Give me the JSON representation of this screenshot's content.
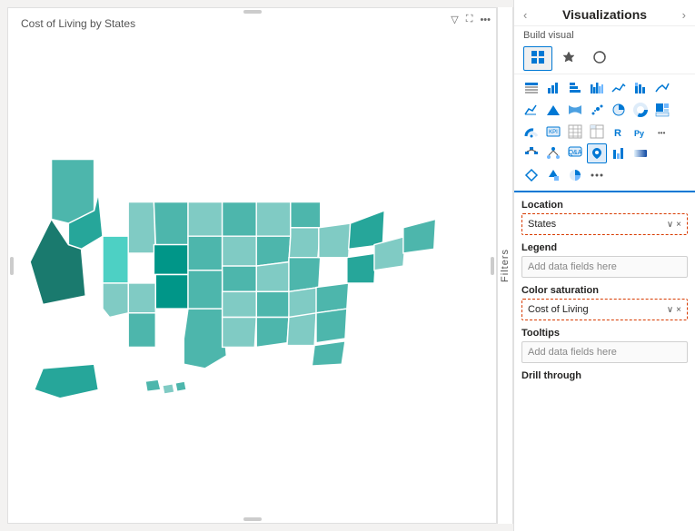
{
  "map": {
    "title": "Cost of Living by States",
    "toolbar_icons": [
      "filter",
      "expand",
      "more"
    ]
  },
  "filters": {
    "label": "Filters"
  },
  "viz_panel": {
    "title": "Visualizations",
    "nav": {
      "back": "‹",
      "forward": "›"
    },
    "build_visual_label": "Build visual",
    "tabs": [
      {
        "id": "build",
        "label": "⊞",
        "active": true
      },
      {
        "id": "format",
        "label": "🖌"
      },
      {
        "id": "analytics",
        "label": "📊"
      }
    ],
    "field_sections": [
      {
        "id": "location",
        "label": "Location",
        "field": {
          "value": "States",
          "has_value": true,
          "placeholder": "Add data fields here"
        }
      },
      {
        "id": "legend",
        "label": "Legend",
        "field": {
          "value": "",
          "has_value": false,
          "placeholder": "Add data fields here"
        }
      },
      {
        "id": "color_saturation",
        "label": "Color saturation",
        "field": {
          "value": "Cost of Living",
          "has_value": true,
          "placeholder": "Add data fields here"
        }
      },
      {
        "id": "tooltips",
        "label": "Tooltips",
        "field": {
          "value": "",
          "has_value": false,
          "placeholder": "Add data fields here"
        }
      },
      {
        "id": "drill_through",
        "label": "Drill through",
        "field": {
          "value": "",
          "has_value": false,
          "placeholder": ""
        }
      }
    ]
  }
}
